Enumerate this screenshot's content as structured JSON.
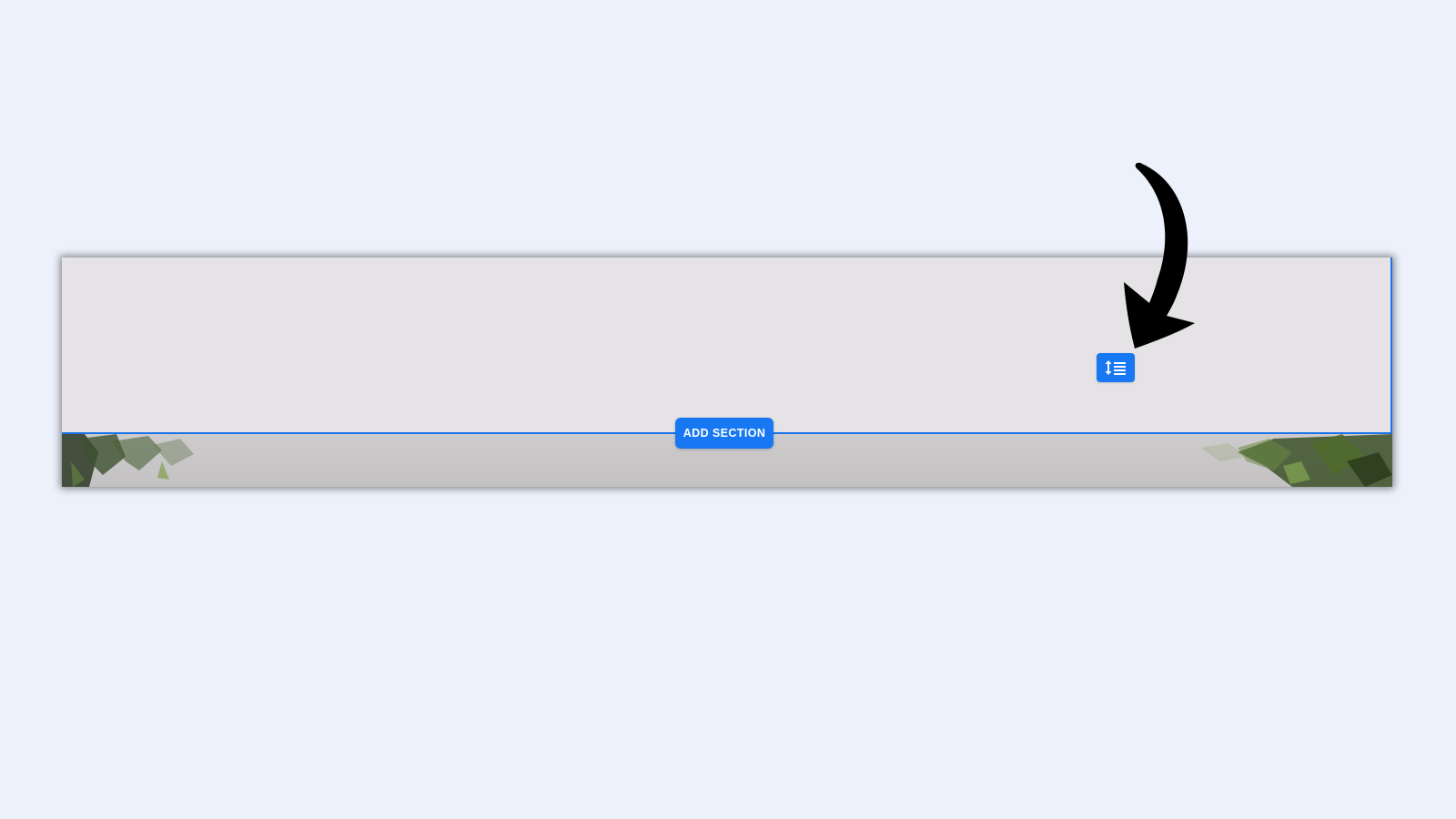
{
  "editor": {
    "add_section_label": "ADD SECTION",
    "spacing_button_icon": "line-spacing-icon",
    "accent_color": "#1877f2",
    "canvas_background": "#ecf1fb"
  },
  "annotation": {
    "arrow_icon": "curved-arrow-icon",
    "arrow_color": "#000000"
  }
}
